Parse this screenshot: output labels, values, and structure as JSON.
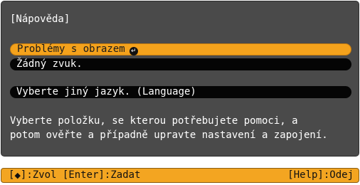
{
  "screen": {
    "title": "[Nápověda]",
    "menu": [
      {
        "label": "Problémy s obrazem",
        "selected": true
      },
      {
        "label": "Žádný zvuk.",
        "selected": false
      },
      {
        "label": "Vyberte jiný jazyk. (Language)",
        "selected": false
      }
    ],
    "enter_icon": "enter-arrow-icon",
    "help_lines": [
      "Vyberte položku, se kterou potřebujete pomoci, a",
      "potom ověřte a případně upravte nastavení a zapojení."
    ]
  },
  "statusbar": {
    "nav_open": "[",
    "nav_glyph": "◆",
    "nav_close": "]:Zvol",
    "enter": "[Enter]:Zadat",
    "help": "[Help]:Odej"
  },
  "colors": {
    "panel_bg": "#4a4a4a",
    "selected_bg": "#f4a21c",
    "item_bg": "#050505",
    "statusbar_bg": "#f3a521"
  }
}
